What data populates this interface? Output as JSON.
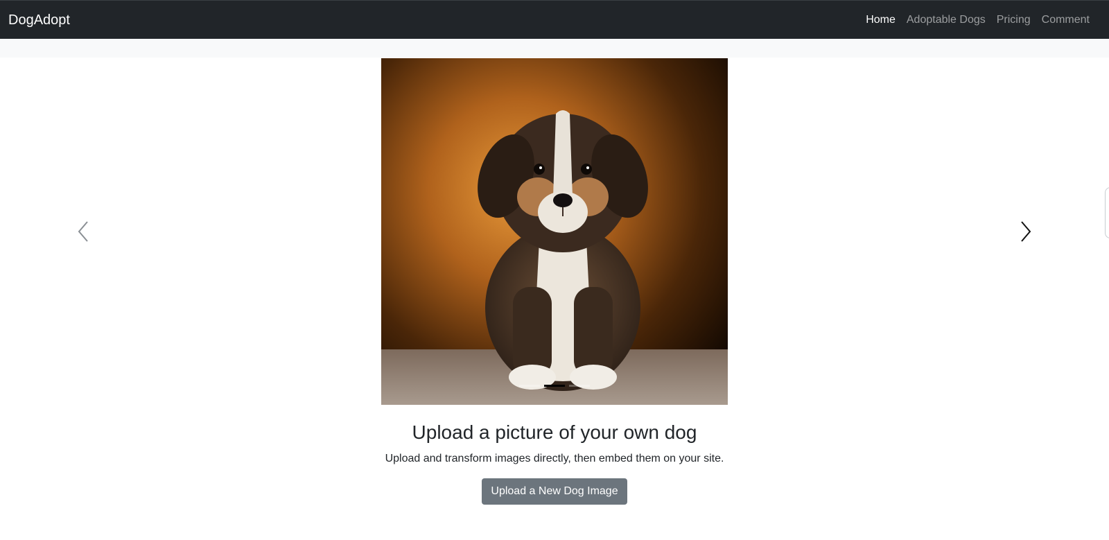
{
  "navbar": {
    "brand": "DogAdopt",
    "links": [
      {
        "label": "Home",
        "active": true
      },
      {
        "label": "Adoptable Dogs",
        "active": false
      },
      {
        "label": "Pricing",
        "active": false
      },
      {
        "label": "Comment",
        "active": false
      }
    ]
  },
  "carousel": {
    "slide_count": 3,
    "active_index": 1,
    "prev_icon": "chevron-left-icon",
    "next_icon": "chevron-right-icon",
    "image_subject": "puppy-photo"
  },
  "caption": {
    "title": "Upload a picture of your own dog",
    "text": "Upload and transform images directly, then embed them on your site.",
    "button_label": "Upload a New Dog Image"
  },
  "colors": {
    "navbar_bg": "#212529",
    "subbar_bg": "#f8f9fa",
    "button_bg": "#6c757d"
  }
}
